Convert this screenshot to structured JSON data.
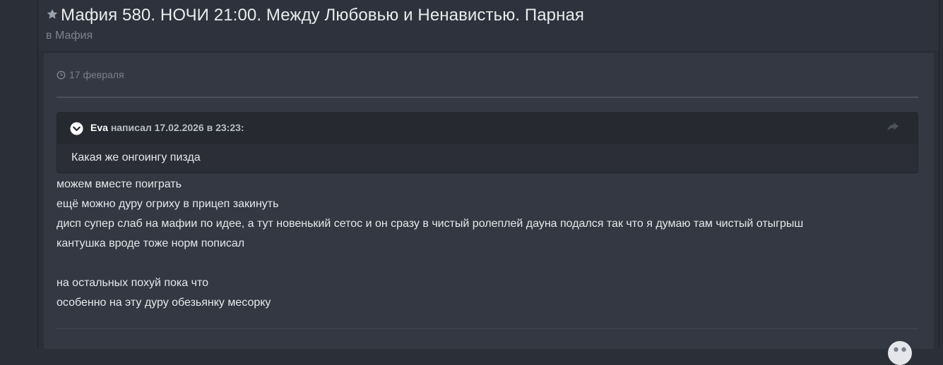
{
  "topic": {
    "title": "Мафия 580. НОЧИ 21:00. Между Любовью и Ненавистью. Парная",
    "forum": "в Мафия",
    "favorite_icon": "star-icon"
  },
  "post": {
    "date": "17 февраля",
    "date_icon": "clock-icon",
    "quote": {
      "toggle_icon": "chevron-down-icon",
      "author": "Eva",
      "meta": "написал 17.02.2026 в 23:23:",
      "share_icon": "share-icon",
      "text": "Какая же онгоингу пизда"
    },
    "lines": [
      "можем вместе поиграть",
      "ещё можно дуру огриху в прицеп закинуть",
      "дисп супер слаб на мафии по идее, а тут новенький сетос и он сразу в чистый ролеплей дауна подался так что я думаю там чистый отыгрыш",
      "кантушка вроде тоже норм пописал",
      "",
      "на остальных похуй пока что",
      "особенно на эту дуру обезьянку месорку"
    ],
    "reaction_icon": "reaction-icon"
  },
  "colors": {
    "background": "#2b2f38",
    "post_background": "#343843",
    "quote_background": "#2b2e37",
    "title_text": "#e9ebee",
    "muted_text": "#7d838d"
  }
}
